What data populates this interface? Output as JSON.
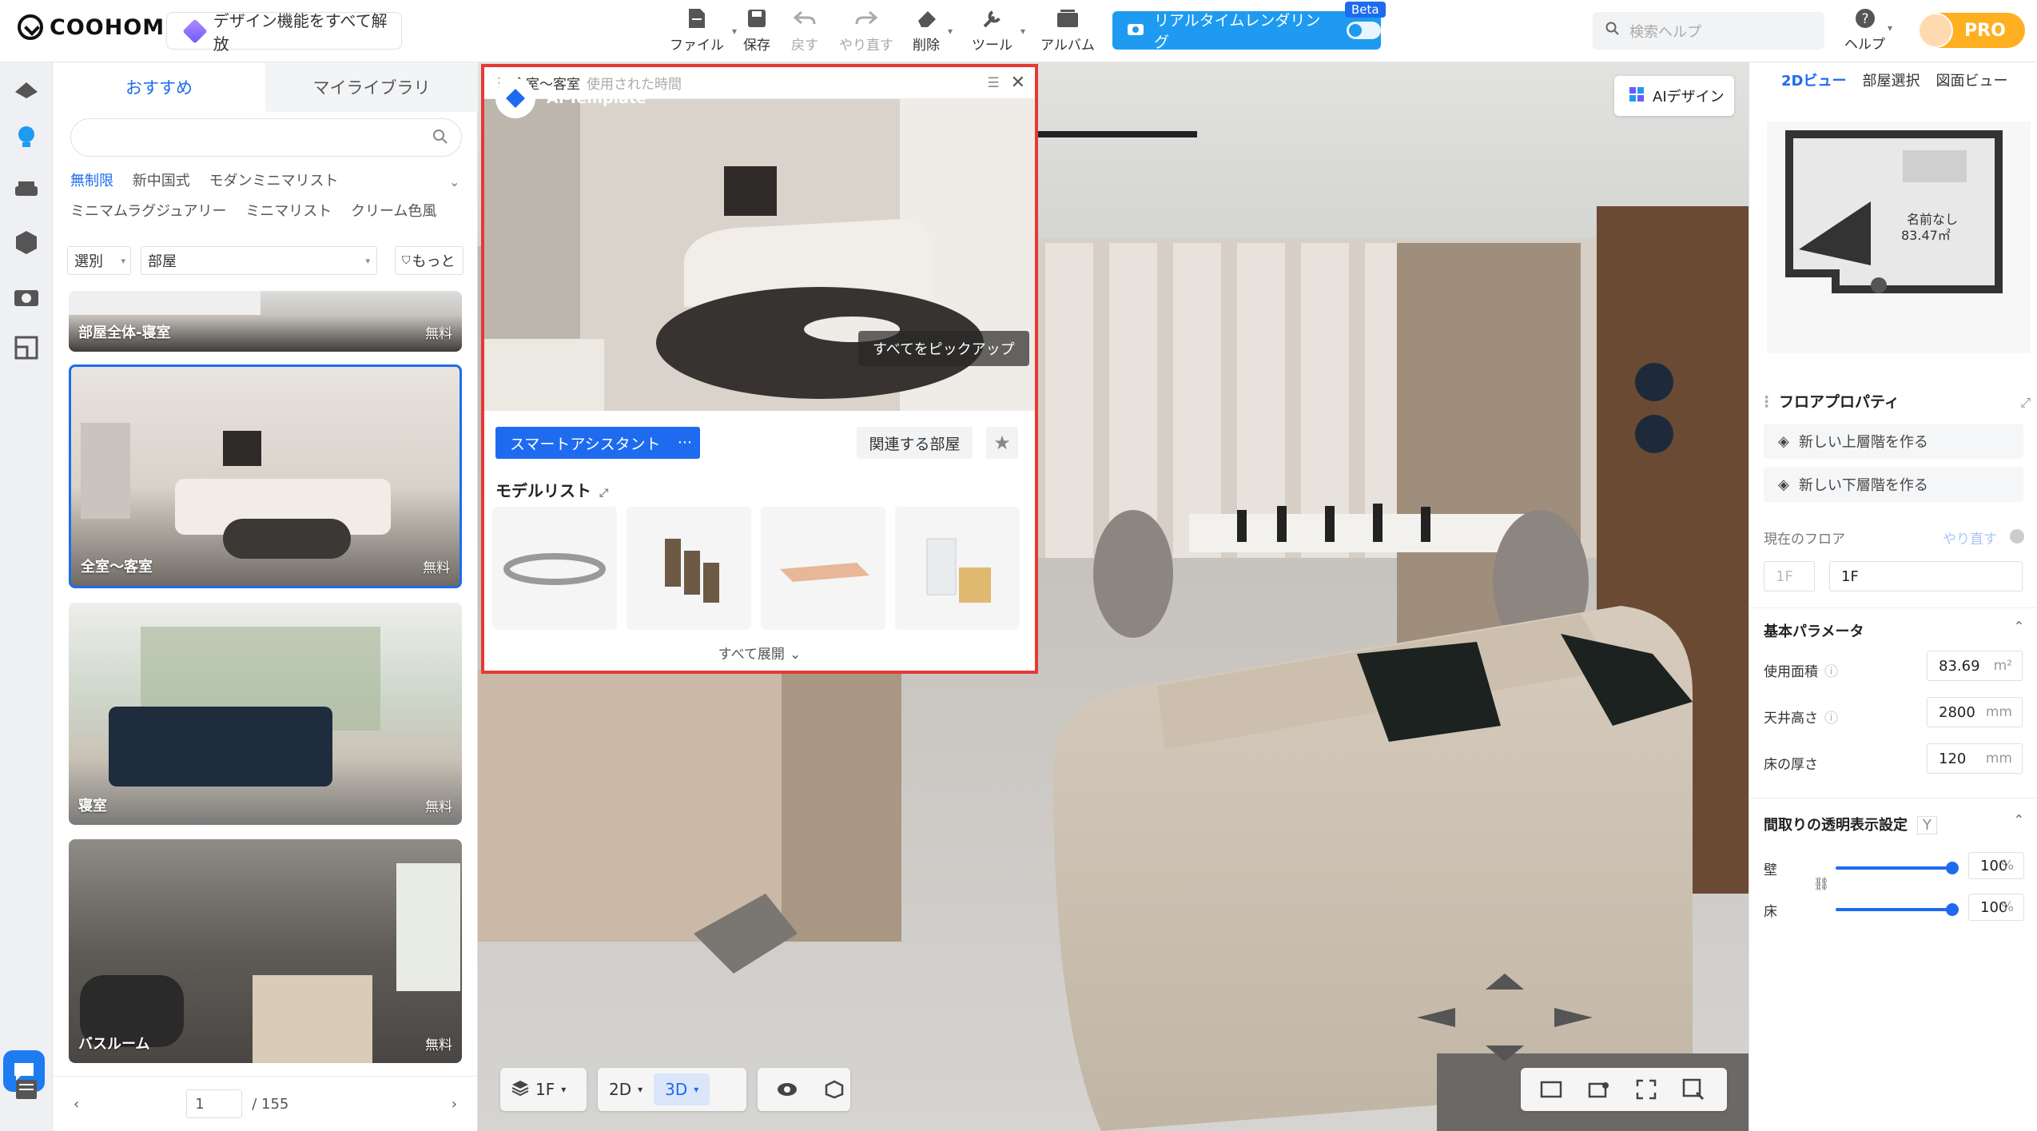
{
  "app": {
    "logo_text": "COOHOM",
    "unlock_label": "デザイン機能をすべて解放",
    "pro_label": "PRO",
    "search_help_placeholder": "検索ヘルプ",
    "help_label": "ヘルプ"
  },
  "toolbar": {
    "file": "ファイル",
    "save": "保存",
    "undo": "戻す",
    "redo": "やり直す",
    "delete": "削除",
    "tools": "ツール",
    "album": "アルバム",
    "realtime_render": "リアルタイムレンダリング",
    "beta": "Beta"
  },
  "left_panel": {
    "tabs": [
      "おすすめ",
      "マイライブラリ"
    ],
    "active_tab": 0,
    "search_placeholder": "",
    "chips_row1": [
      "無制限",
      "新中国式",
      "モダンミニマリスト"
    ],
    "chips_row2": [
      "ミニマムラグジュアリー",
      "ミニマリスト",
      "クリーム色風"
    ],
    "filter_select": "選別",
    "room_select": "部屋",
    "more_label": "もっと",
    "cards": [
      {
        "label": "部屋全体-寝室",
        "badge": "無料"
      },
      {
        "label": "全室〜客室",
        "badge": "無料"
      },
      {
        "label": "寝室",
        "badge": "無料"
      },
      {
        "label": "バスルーム",
        "badge": "無料"
      }
    ],
    "page_current": "1",
    "page_total": "/ 155"
  },
  "popup": {
    "title": "全室〜客室",
    "subtitle": "使用された時間",
    "ai_template_label": "AI-Template",
    "pick_all": "すべてをピックアップ",
    "smart_assistant": "スマートアシスタント",
    "smart_more": "···",
    "related_rooms": "関連する部屋",
    "model_list_title": "モデルリスト",
    "expand_all": "すべて展開"
  },
  "viewport": {
    "ai_design": "AIデザイン",
    "floor": "1F",
    "view_2d": "2D",
    "view_3d": "3D"
  },
  "right_panel": {
    "tabs": [
      "2Dビュー",
      "部屋選択",
      "図面ビュー"
    ],
    "minimap_room_name": "名前なし",
    "minimap_room_area": "83.47㎡",
    "floor_props_title": "フロアプロパティ",
    "new_upper_floor": "新しい上層階を作る",
    "new_lower_floor": "新しい下層階を作る",
    "current_floor_label": "現在のフロア",
    "redo_label": "やり直す",
    "floor_short": "1F",
    "floor_name": "1F",
    "basic_params_title": "基本パラメータ",
    "area_label": "使用面積",
    "area_value": "83.69",
    "area_unit": "m²",
    "ceiling_label": "天井高さ",
    "ceiling_value": "2800",
    "ceiling_unit": "mm",
    "floor_thickness_label": "床の厚さ",
    "floor_thickness_value": "120",
    "floor_thickness_unit": "mm",
    "transparency_title": "間取りの透明表示設定",
    "transparency_key": "Y",
    "wall_label": "壁",
    "wall_value": "100",
    "floor_label": "床",
    "floor_value": "100",
    "percent": "%",
    "wall_level": 1.0,
    "floor_level": 1.0
  }
}
